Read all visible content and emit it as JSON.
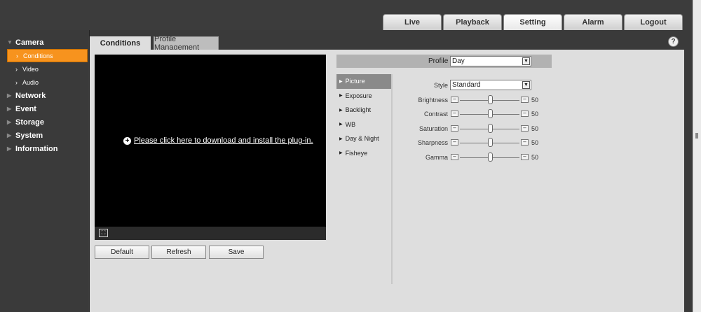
{
  "top_tabs": [
    "Live",
    "Playback",
    "Setting",
    "Alarm",
    "Logout"
  ],
  "sidebar": {
    "camera": "Camera",
    "sub_items": [
      "Conditions",
      "Video",
      "Audio"
    ],
    "categories": [
      "Network",
      "Event",
      "Storage",
      "System",
      "Information"
    ]
  },
  "content_tabs": [
    "Conditions",
    "Profile Management"
  ],
  "help_icon": "?",
  "video": {
    "plugin_text": "Please click here to download and install the plug-in."
  },
  "buttons": [
    "Default",
    "Refresh",
    "Save"
  ],
  "profile": {
    "label": "Profile",
    "value": "Day"
  },
  "submenu": [
    "Picture",
    "Exposure",
    "Backlight",
    "WB",
    "Day & Night",
    "Fisheye"
  ],
  "picture": {
    "style_label": "Style",
    "style_value": "Standard",
    "sliders": [
      {
        "label": "Brightness",
        "value": 50
      },
      {
        "label": "Contrast",
        "value": 50
      },
      {
        "label": "Saturation",
        "value": 50
      },
      {
        "label": "Sharpness",
        "value": 50
      },
      {
        "label": "Gamma",
        "value": 50
      }
    ]
  },
  "colors": {
    "accent": "#f7931e",
    "sidebar_bg": "#3a3a3a",
    "panel_bg": "#dedede"
  }
}
